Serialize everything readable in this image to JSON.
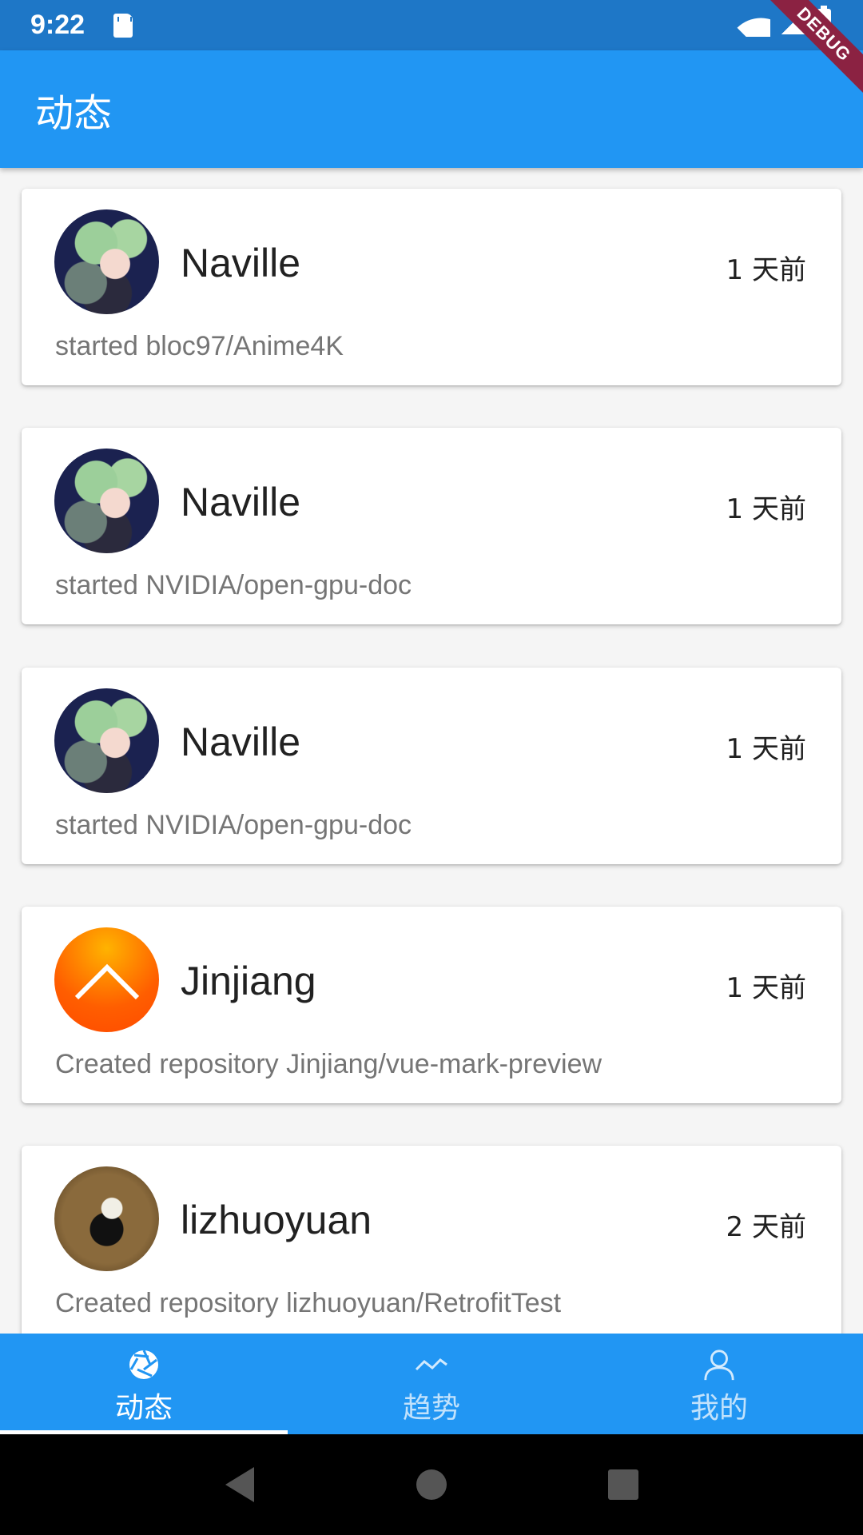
{
  "status_bar": {
    "time": "9:22",
    "icons": [
      "sd-card-icon",
      "wifi-icon",
      "signal-icon",
      "battery-icon"
    ]
  },
  "debug_banner": "DEBUG",
  "app_bar": {
    "title": "动态"
  },
  "feed": [
    {
      "name": "Naville",
      "time": "1 天前",
      "action": "started bloc97/Anime4K",
      "avatar": "anime"
    },
    {
      "name": "Naville",
      "time": "1 天前",
      "action": "started NVIDIA/open-gpu-doc",
      "avatar": "anime"
    },
    {
      "name": "Naville",
      "time": "1 天前",
      "action": "started NVIDIA/open-gpu-doc",
      "avatar": "anime"
    },
    {
      "name": "Jinjiang",
      "time": "1 天前",
      "action": "Created repository Jinjiang/vue-mark-preview",
      "avatar": "orange"
    },
    {
      "name": "lizhuoyuan",
      "time": "2 天前",
      "action": "Created repository lizhuoyuan/RetrofitTest",
      "avatar": "brown"
    }
  ],
  "bottom_nav": {
    "items": [
      {
        "label": "动态",
        "icon": "aperture-icon",
        "active": true
      },
      {
        "label": "趋势",
        "icon": "trend-icon",
        "active": false
      },
      {
        "label": "我的",
        "icon": "person-icon",
        "active": false
      }
    ]
  },
  "colors": {
    "primary": "#2196F3",
    "status_bar": "#1E77C7",
    "debug": "#8B2242"
  }
}
